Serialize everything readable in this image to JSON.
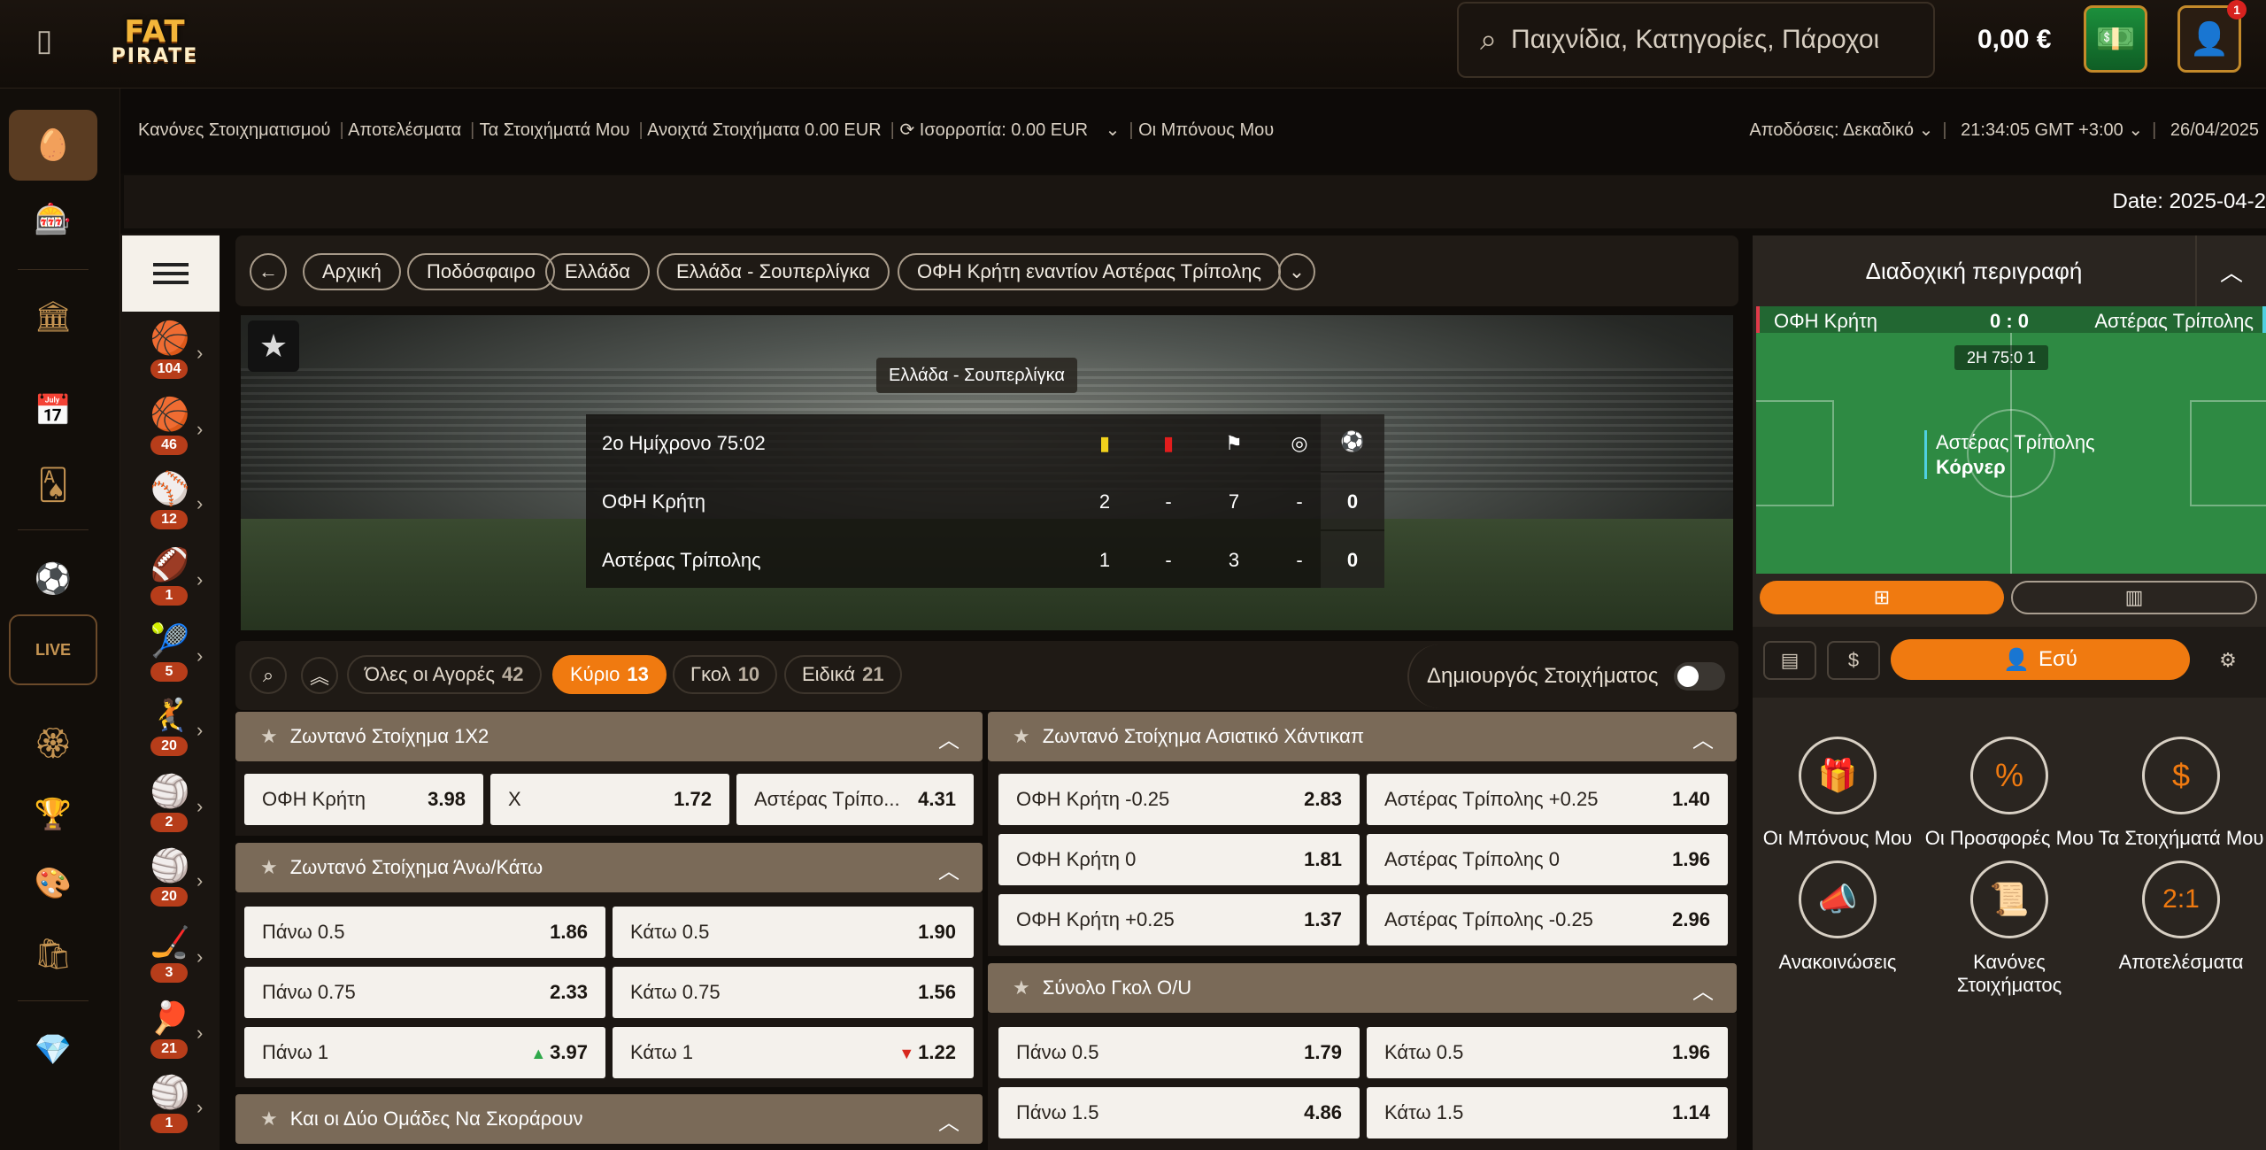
{
  "header": {
    "logo_top": "FAT",
    "logo_bottom": "PIRATE",
    "search_placeholder": "Παιχνίδια, Κατηγορίες, Πάροχοι",
    "balance": "0,00 €",
    "notification_count": "1"
  },
  "rail": {
    "live_label": "LIVE"
  },
  "infobar": {
    "links": [
      "Κανόνες Στοιχηματισμού",
      "Αποτελέσματα",
      "Τα Στοιχήματά Μου",
      "Ανοιχτά Στοιχήματα 0.00 EUR",
      "Ισορροπία:  0.00 EUR",
      "Οι Μπόνους Μου"
    ],
    "odds_format": "Αποδόσεις: Δεκαδικό",
    "time": "21:34:05 GMT +3:00",
    "date": "26/04/2025"
  },
  "datebar": {
    "text": "Date: 2025-04-2"
  },
  "sports": [
    {
      "icon": "🏀",
      "count": "104"
    },
    {
      "icon": "🏀",
      "count": "46"
    },
    {
      "icon": "⚾",
      "count": "12"
    },
    {
      "icon": "🏈",
      "count": "1"
    },
    {
      "icon": "🎾",
      "count": "5"
    },
    {
      "icon": "🤾",
      "count": "20"
    },
    {
      "icon": "🏐",
      "count": "2"
    },
    {
      "icon": "🏐",
      "count": "20"
    },
    {
      "icon": "🏒",
      "count": "3"
    },
    {
      "icon": "🏓",
      "count": "21"
    },
    {
      "icon": "🏐",
      "count": "1"
    }
  ],
  "breadcrumb": [
    "Αρχική",
    "Ποδόσφαιρο",
    "Ελλάδα",
    "Ελλάδα - Σουπερλίγκα",
    "ΟΦΗ Κρήτη εναντίον Αστέρας Τρίπολης"
  ],
  "match": {
    "league": "Ελλάδα - Σουπερλίγκα",
    "period": "2ο Ημίχρονο 75:02",
    "home": {
      "name": "ΟΦΗ Κρήτη",
      "yellow": "2",
      "red": "-",
      "corners": "7",
      "pen": "-",
      "goals": "0"
    },
    "away": {
      "name": "Αστέρας Τρίπολης",
      "yellow": "1",
      "red": "-",
      "corners": "3",
      "pen": "-",
      "goals": "0"
    }
  },
  "tabs": [
    {
      "label": "Όλες οι Αγορές",
      "count": "42"
    },
    {
      "label": "Κύριο",
      "count": "13"
    },
    {
      "label": "Γκολ",
      "count": "10"
    },
    {
      "label": "Ειδικά",
      "count": "21"
    }
  ],
  "bet_builder": "Δημιουργός Στοιχήματος",
  "markets": {
    "m1x2": {
      "title": "Ζωντανό Στοίχημα 1X2",
      "odds": [
        {
          "label": "ΟΦΗ Κρήτη",
          "value": "3.98"
        },
        {
          "label": "X",
          "value": "1.72"
        },
        {
          "label": "Αστέρας Τρίπο...",
          "value": "4.31"
        }
      ]
    },
    "ou": {
      "title": "Ζωντανό Στοίχημα Άνω/Κάτω",
      "rows": [
        [
          {
            "label": "Πάνω 0.5",
            "value": "1.86"
          },
          {
            "label": "Κάτω 0.5",
            "value": "1.90"
          }
        ],
        [
          {
            "label": "Πάνω 0.75",
            "value": "2.33"
          },
          {
            "label": "Κάτω 0.75",
            "value": "1.56"
          }
        ],
        [
          {
            "label": "Πάνω 1",
            "value": "3.97"
          },
          {
            "label": "Κάτω 1",
            "value": "1.22"
          }
        ]
      ]
    },
    "btts": {
      "title": "Και οι Δύο Ομάδες Να Σκοράρουν"
    },
    "ah": {
      "title": "Ζωντανό Στοίχημα Ασιατικό Χάντικαπ",
      "rows": [
        [
          {
            "label": "ΟΦΗ Κρήτη -0.25",
            "value": "2.83"
          },
          {
            "label": "Αστέρας Τρίπολης +0.25",
            "value": "1.40"
          }
        ],
        [
          {
            "label": "ΟΦΗ Κρήτη 0",
            "value": "1.81"
          },
          {
            "label": "Αστέρας Τρίπολης 0",
            "value": "1.96"
          }
        ],
        [
          {
            "label": "ΟΦΗ Κρήτη +0.25",
            "value": "1.37"
          },
          {
            "label": "Αστέρας Τρίπολης -0.25",
            "value": "2.96"
          }
        ]
      ]
    },
    "total": {
      "title": "Σύνολο Γκολ Ο/U",
      "rows": [
        [
          {
            "label": "Πάνω 0.5",
            "value": "1.79"
          },
          {
            "label": "Κάτω 0.5",
            "value": "1.96"
          }
        ],
        [
          {
            "label": "Πάνω 1.5",
            "value": "4.86"
          },
          {
            "label": "Κάτω 1.5",
            "value": "1.14"
          }
        ]
      ]
    }
  },
  "right": {
    "title": "Διαδοχική περιγραφή",
    "home": "ΟΦΗ Κρήτη",
    "score": "0 : 0",
    "away": "Αστέρας Τρίπολης",
    "minute": "2Η 75:0 1",
    "event_team": "Αστέρας Τρίπολης",
    "event_type": "Κόρνερ",
    "you_label": "Εσύ",
    "grid": [
      {
        "icon": "🎁",
        "label": "Οι Μπόνους Μου"
      },
      {
        "icon": "%",
        "label": "Οι Προσφορές Μου"
      },
      {
        "icon": "$",
        "label": "Τα Στοιχήματά Μου"
      },
      {
        "icon": "📣",
        "label": "Ανακοινώσεις"
      },
      {
        "icon": "📜",
        "label": "Κανόνες Στοιχήματος"
      },
      {
        "icon": "2:1",
        "label": "Αποτελέσματα"
      }
    ]
  }
}
